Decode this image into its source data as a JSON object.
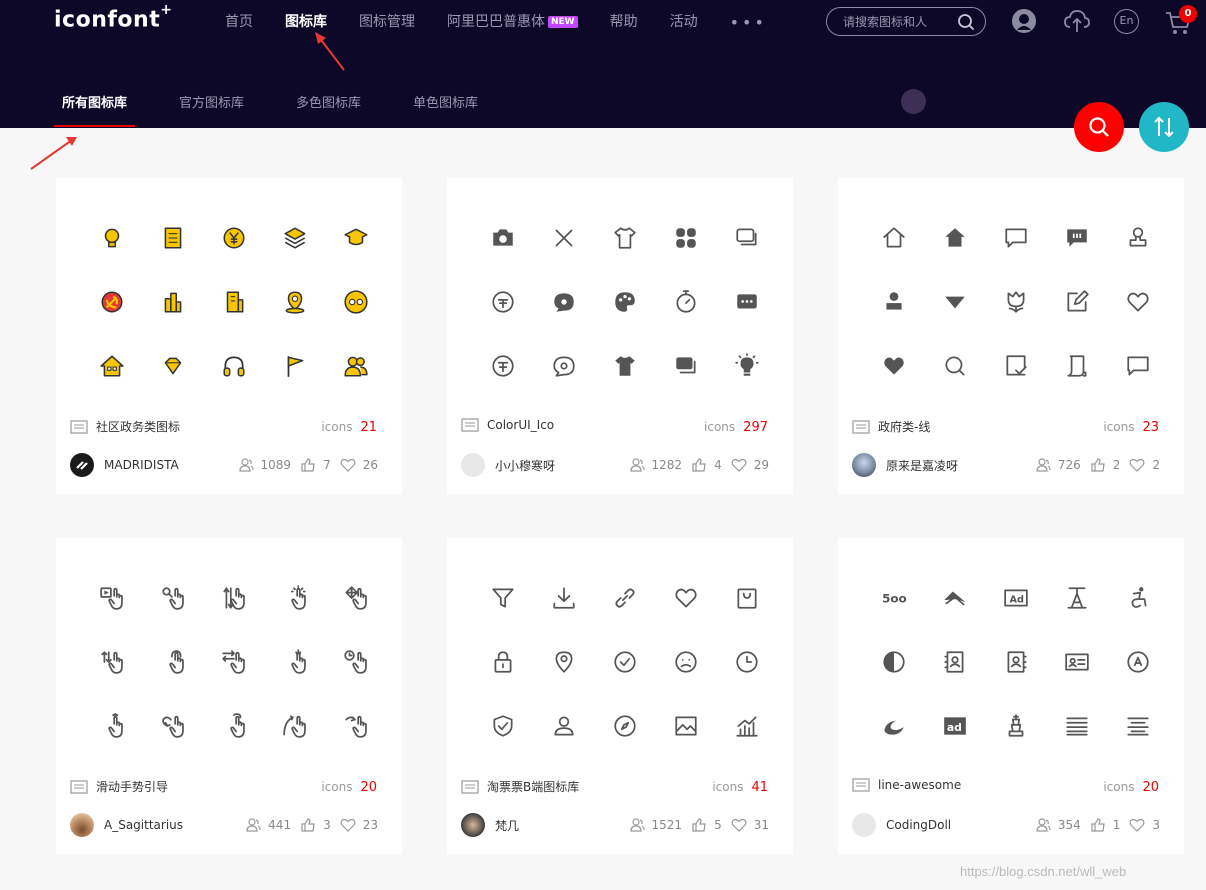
{
  "app": {
    "logo": "iconfont",
    "logo_sup": "+"
  },
  "nav": [
    {
      "label": "首页"
    },
    {
      "label": "图标库",
      "active": true
    },
    {
      "label": "图标管理"
    },
    {
      "label": "阿里巴巴普惠体",
      "badge": "NEW"
    },
    {
      "label": "帮助"
    },
    {
      "label": "活动"
    }
  ],
  "nav_more": "•••",
  "search": {
    "placeholder": "请搜索图标和人"
  },
  "header_icons": [
    "avatar-icon",
    "upload-cloud-icon",
    "language-en-icon",
    "cart-icon"
  ],
  "lang_label": "En",
  "cart_count": "0",
  "subnav": [
    {
      "label": "所有图标库",
      "active": true
    },
    {
      "label": "官方图标库"
    },
    {
      "label": "多色图标库"
    },
    {
      "label": "单色图标库"
    }
  ],
  "colors": {
    "header_bg": "#0d0828",
    "accent_red": "#e40000",
    "count_red": "#e00000",
    "sort_teal": "#22b7c6",
    "icon_yellow": "#f7c600"
  },
  "cards": [
    {
      "title": "社区政务类图标",
      "icons_label": "icons",
      "count": "21",
      "user": "MADRIDISTA",
      "views": "1089",
      "likes": "7",
      "favs": "26",
      "icons": [
        "bulb",
        "notebook",
        "yen-coin",
        "layers",
        "graduation-cap",
        "party-emblem",
        "buildings",
        "office-building",
        "map-pin",
        "face",
        "house",
        "diamond",
        "headphones",
        "flag",
        "users"
      ]
    },
    {
      "title": "ColorUI_Ico",
      "icons_label": "icons",
      "count": "297",
      "user": "小小穆寒呀",
      "views": "1282",
      "likes": "4",
      "favs": "29",
      "icons": [
        "camera",
        "close",
        "tshirt",
        "apps",
        "comments",
        "coin",
        "chat-bubble",
        "palette",
        "stopwatch",
        "message",
        "coin-outline",
        "chat-outline",
        "tshirt-filled",
        "comments-filled",
        "lightbulb"
      ]
    },
    {
      "title": "政府类-线",
      "icons_label": "icons",
      "count": "23",
      "user": "原来是嘉凌呀",
      "views": "726",
      "likes": "2",
      "favs": "2",
      "icons": [
        "home",
        "home-filled",
        "comment",
        "comment-filled",
        "stamp",
        "stamp-filled",
        "triangle-down",
        "tulip",
        "edit",
        "heart",
        "heart-filled",
        "search",
        "checklist",
        "scroll",
        "message-square"
      ]
    },
    {
      "title": "滑动手势引导",
      "icons_label": "icons",
      "count": "20",
      "user": "A_Sagittarius",
      "views": "441",
      "likes": "3",
      "favs": "23",
      "icons": [
        "play-hand",
        "zoom-hand",
        "swipe-vertical-hand",
        "tap-hand",
        "move-hand",
        "swipe-up-hand",
        "double-tap-hand",
        "swipe-horizontal-hand",
        "press-hand",
        "clock-hand",
        "point-up-hand",
        "rotate-hand",
        "hold-hand",
        "flick-hand",
        "scroll-hand"
      ]
    },
    {
      "title": "淘票票B端图标库",
      "icons_label": "icons",
      "count": "41",
      "user": "梵几",
      "views": "1521",
      "likes": "5",
      "favs": "31",
      "icons": [
        "filter",
        "download",
        "link",
        "heart",
        "bag",
        "lock",
        "location",
        "check-circle",
        "sad-face",
        "clock",
        "shield-check",
        "user",
        "compass",
        "image",
        "chart"
      ]
    },
    {
      "title": "line-awesome",
      "icons_label": "icons",
      "count": "20",
      "user": "CodingDoll",
      "views": "354",
      "likes": "1",
      "favs": "3",
      "icons": [
        "500px",
        "aerial",
        "ad",
        "typo",
        "accessible",
        "adjust",
        "address-book",
        "address-book-alt",
        "address-card",
        "angellist",
        "sanity",
        "ad-filled",
        "chess",
        "align-justify",
        "align-center"
      ]
    }
  ],
  "watermark": "https://blog.csdn.net/wll_web"
}
